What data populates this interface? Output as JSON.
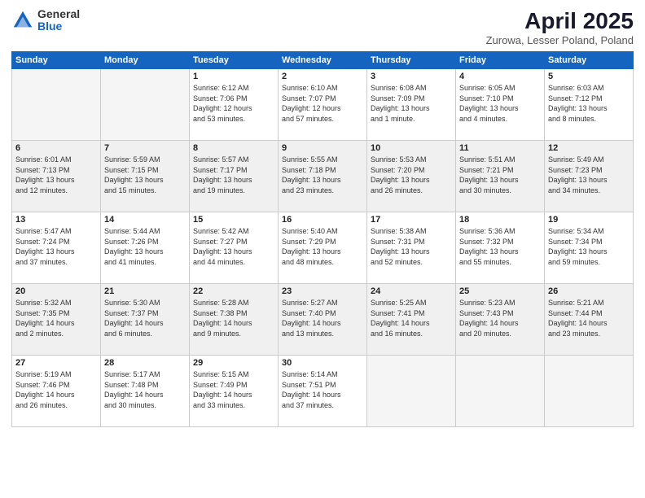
{
  "header": {
    "logo_general": "General",
    "logo_blue": "Blue",
    "title": "April 2025",
    "subtitle": "Zurowa, Lesser Poland, Poland"
  },
  "days_of_week": [
    "Sunday",
    "Monday",
    "Tuesday",
    "Wednesday",
    "Thursday",
    "Friday",
    "Saturday"
  ],
  "weeks": [
    [
      {
        "num": "",
        "info": ""
      },
      {
        "num": "",
        "info": ""
      },
      {
        "num": "1",
        "info": "Sunrise: 6:12 AM\nSunset: 7:06 PM\nDaylight: 12 hours\nand 53 minutes."
      },
      {
        "num": "2",
        "info": "Sunrise: 6:10 AM\nSunset: 7:07 PM\nDaylight: 12 hours\nand 57 minutes."
      },
      {
        "num": "3",
        "info": "Sunrise: 6:08 AM\nSunset: 7:09 PM\nDaylight: 13 hours\nand 1 minute."
      },
      {
        "num": "4",
        "info": "Sunrise: 6:05 AM\nSunset: 7:10 PM\nDaylight: 13 hours\nand 4 minutes."
      },
      {
        "num": "5",
        "info": "Sunrise: 6:03 AM\nSunset: 7:12 PM\nDaylight: 13 hours\nand 8 minutes."
      }
    ],
    [
      {
        "num": "6",
        "info": "Sunrise: 6:01 AM\nSunset: 7:13 PM\nDaylight: 13 hours\nand 12 minutes."
      },
      {
        "num": "7",
        "info": "Sunrise: 5:59 AM\nSunset: 7:15 PM\nDaylight: 13 hours\nand 15 minutes."
      },
      {
        "num": "8",
        "info": "Sunrise: 5:57 AM\nSunset: 7:17 PM\nDaylight: 13 hours\nand 19 minutes."
      },
      {
        "num": "9",
        "info": "Sunrise: 5:55 AM\nSunset: 7:18 PM\nDaylight: 13 hours\nand 23 minutes."
      },
      {
        "num": "10",
        "info": "Sunrise: 5:53 AM\nSunset: 7:20 PM\nDaylight: 13 hours\nand 26 minutes."
      },
      {
        "num": "11",
        "info": "Sunrise: 5:51 AM\nSunset: 7:21 PM\nDaylight: 13 hours\nand 30 minutes."
      },
      {
        "num": "12",
        "info": "Sunrise: 5:49 AM\nSunset: 7:23 PM\nDaylight: 13 hours\nand 34 minutes."
      }
    ],
    [
      {
        "num": "13",
        "info": "Sunrise: 5:47 AM\nSunset: 7:24 PM\nDaylight: 13 hours\nand 37 minutes."
      },
      {
        "num": "14",
        "info": "Sunrise: 5:44 AM\nSunset: 7:26 PM\nDaylight: 13 hours\nand 41 minutes."
      },
      {
        "num": "15",
        "info": "Sunrise: 5:42 AM\nSunset: 7:27 PM\nDaylight: 13 hours\nand 44 minutes."
      },
      {
        "num": "16",
        "info": "Sunrise: 5:40 AM\nSunset: 7:29 PM\nDaylight: 13 hours\nand 48 minutes."
      },
      {
        "num": "17",
        "info": "Sunrise: 5:38 AM\nSunset: 7:31 PM\nDaylight: 13 hours\nand 52 minutes."
      },
      {
        "num": "18",
        "info": "Sunrise: 5:36 AM\nSunset: 7:32 PM\nDaylight: 13 hours\nand 55 minutes."
      },
      {
        "num": "19",
        "info": "Sunrise: 5:34 AM\nSunset: 7:34 PM\nDaylight: 13 hours\nand 59 minutes."
      }
    ],
    [
      {
        "num": "20",
        "info": "Sunrise: 5:32 AM\nSunset: 7:35 PM\nDaylight: 14 hours\nand 2 minutes."
      },
      {
        "num": "21",
        "info": "Sunrise: 5:30 AM\nSunset: 7:37 PM\nDaylight: 14 hours\nand 6 minutes."
      },
      {
        "num": "22",
        "info": "Sunrise: 5:28 AM\nSunset: 7:38 PM\nDaylight: 14 hours\nand 9 minutes."
      },
      {
        "num": "23",
        "info": "Sunrise: 5:27 AM\nSunset: 7:40 PM\nDaylight: 14 hours\nand 13 minutes."
      },
      {
        "num": "24",
        "info": "Sunrise: 5:25 AM\nSunset: 7:41 PM\nDaylight: 14 hours\nand 16 minutes."
      },
      {
        "num": "25",
        "info": "Sunrise: 5:23 AM\nSunset: 7:43 PM\nDaylight: 14 hours\nand 20 minutes."
      },
      {
        "num": "26",
        "info": "Sunrise: 5:21 AM\nSunset: 7:44 PM\nDaylight: 14 hours\nand 23 minutes."
      }
    ],
    [
      {
        "num": "27",
        "info": "Sunrise: 5:19 AM\nSunset: 7:46 PM\nDaylight: 14 hours\nand 26 minutes."
      },
      {
        "num": "28",
        "info": "Sunrise: 5:17 AM\nSunset: 7:48 PM\nDaylight: 14 hours\nand 30 minutes."
      },
      {
        "num": "29",
        "info": "Sunrise: 5:15 AM\nSunset: 7:49 PM\nDaylight: 14 hours\nand 33 minutes."
      },
      {
        "num": "30",
        "info": "Sunrise: 5:14 AM\nSunset: 7:51 PM\nDaylight: 14 hours\nand 37 minutes."
      },
      {
        "num": "",
        "info": ""
      },
      {
        "num": "",
        "info": ""
      },
      {
        "num": "",
        "info": ""
      }
    ]
  ]
}
